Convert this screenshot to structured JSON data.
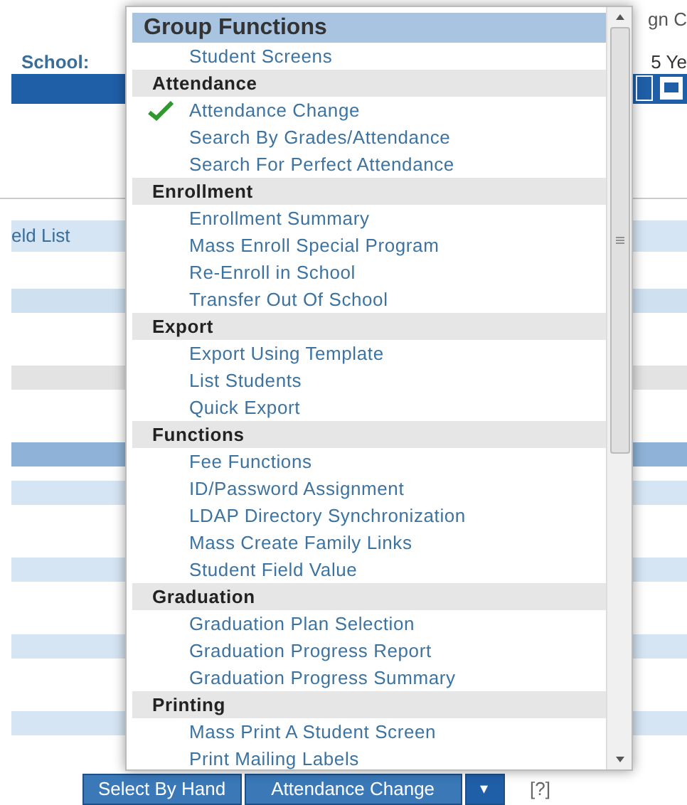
{
  "page": {
    "top_right_text": "gn C",
    "school_label": "School:",
    "year_text": "5 Ye",
    "field_list_text": "eld List"
  },
  "menu": {
    "title": "Group Functions",
    "items": [
      {
        "label": "Student Screens",
        "checked": false
      }
    ],
    "groups": [
      {
        "label": "Attendance",
        "items": [
          {
            "label": "Attendance Change",
            "checked": true
          },
          {
            "label": "Search By Grades/Attendance",
            "checked": false
          },
          {
            "label": "Search For Perfect Attendance",
            "checked": false
          }
        ]
      },
      {
        "label": "Enrollment",
        "items": [
          {
            "label": "Enrollment Summary",
            "checked": false
          },
          {
            "label": "Mass Enroll Special Program",
            "checked": false
          },
          {
            "label": "Re-Enroll in School",
            "checked": false
          },
          {
            "label": "Transfer Out Of School",
            "checked": false
          }
        ]
      },
      {
        "label": "Export",
        "items": [
          {
            "label": "Export Using Template",
            "checked": false
          },
          {
            "label": "List Students",
            "checked": false
          },
          {
            "label": "Quick Export",
            "checked": false
          }
        ]
      },
      {
        "label": "Functions",
        "items": [
          {
            "label": "Fee Functions",
            "checked": false
          },
          {
            "label": "ID/Password Assignment",
            "checked": false
          },
          {
            "label": "LDAP Directory Synchronization",
            "checked": false
          },
          {
            "label": "Mass Create Family Links",
            "checked": false
          },
          {
            "label": "Student Field Value",
            "checked": false
          }
        ]
      },
      {
        "label": "Graduation",
        "items": [
          {
            "label": "Graduation Plan Selection",
            "checked": false
          },
          {
            "label": "Graduation Progress Report",
            "checked": false
          },
          {
            "label": "Graduation Progress Summary",
            "checked": false
          }
        ]
      },
      {
        "label": "Printing",
        "items": [
          {
            "label": "Mass Print A Student Screen",
            "checked": false
          },
          {
            "label": "Print Mailing Labels",
            "checked": false
          }
        ]
      }
    ]
  },
  "footer": {
    "buttons": [
      "Select By Hand",
      "Attendance Change"
    ],
    "dropdown_caret": "▾",
    "help": "[?]"
  }
}
